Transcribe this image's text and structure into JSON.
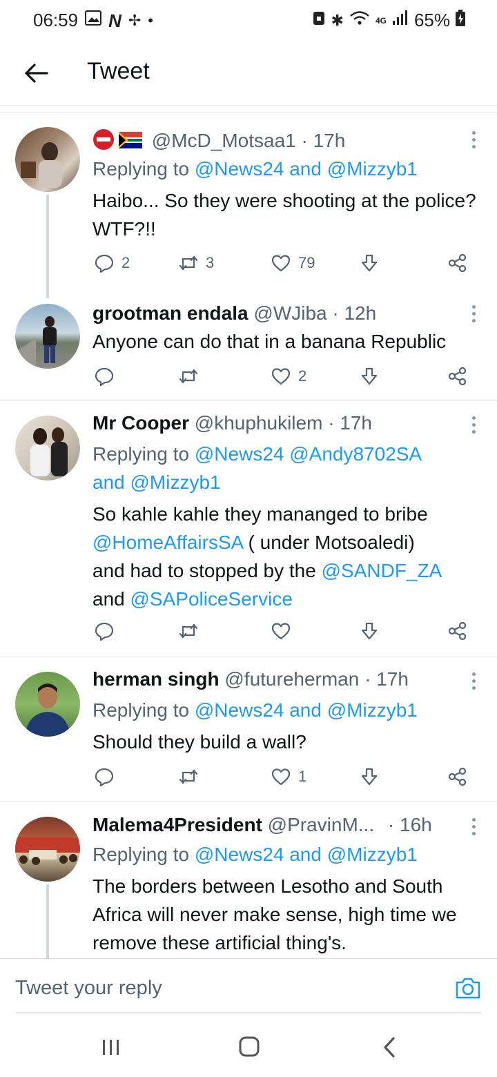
{
  "status": {
    "time": "06:59",
    "battery": "65%",
    "network": "4G"
  },
  "header": {
    "title": "Tweet"
  },
  "tweets": [
    {
      "name": "",
      "handle": "@McD_Motsaa1",
      "time": "· 17h",
      "replying_prefix": "Replying to",
      "replying_users": "@News24 and @Mizzyb1",
      "text": "Haibo... So they were shooting at the police? WTF?!!",
      "replies": "2",
      "retweets": "3",
      "likes": "79"
    },
    {
      "name": "grootman endala",
      "handle": "@WJiba",
      "time": "· 12h",
      "text": "Anyone can do that in a banana Republic",
      "replies": "",
      "retweets": "",
      "likes": "2"
    },
    {
      "name": "Mr Cooper",
      "handle": "@khuphukilem",
      "time": "· 17h",
      "replying_prefix": "Replying to",
      "replying_users_1": "@News24 @Andy8702SA",
      "replying_users_2": "and @Mizzyb1",
      "text_1": "So kahle kahle they mananged to bribe",
      "link_1": "@HomeAffairsSA",
      "text_2": " ( under Motsoaledi)",
      "text_3": "and had to stopped by the ",
      "link_2": "@SANDF_ZA",
      "text_4": "and ",
      "link_3": "@SAPoliceService",
      "replies": "",
      "retweets": "",
      "likes": ""
    },
    {
      "name": "herman singh",
      "handle": "@futureherman",
      "time": "· 17h",
      "replying_prefix": "Replying to",
      "replying_users": "@News24 and @Mizzyb1",
      "text": "Should they build a wall?",
      "replies": "",
      "retweets": "",
      "likes": "1"
    },
    {
      "name": "Malema4President",
      "handle": "@PravinM...",
      "time": "· 16h",
      "replying_prefix": "Replying to",
      "replying_users": "@News24 and @Mizzyb1",
      "text": "The borders between Lesotho and South Africa will never make sense, high time we remove these artificial thing's."
    }
  ],
  "composer": {
    "placeholder": "Tweet your reply"
  },
  "colors": {
    "link": "#1d9bf0",
    "secondary": "#536471",
    "divider": "#e6ecf0"
  }
}
